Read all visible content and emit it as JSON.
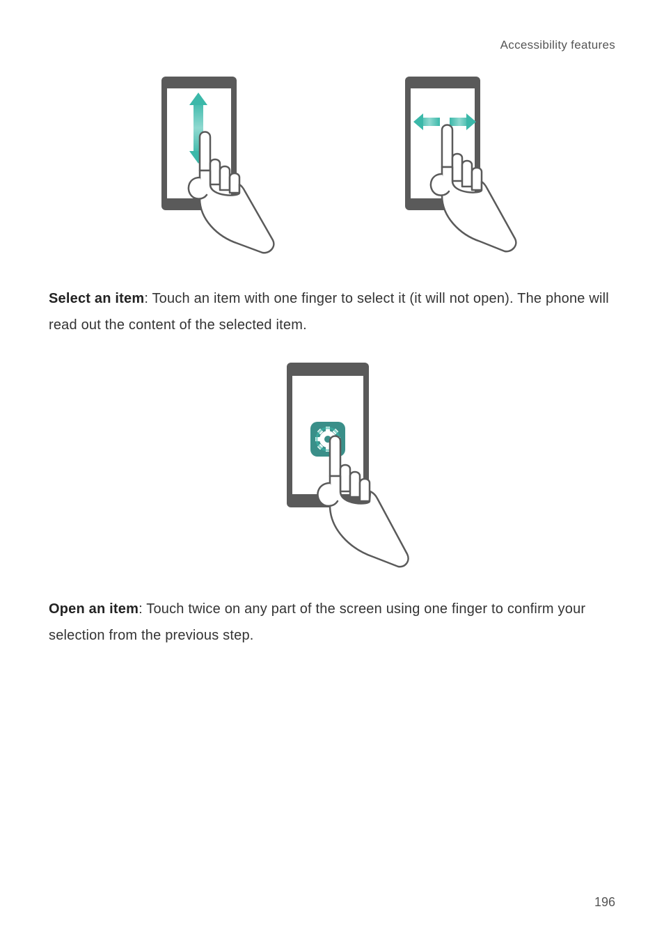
{
  "header": {
    "section_title": "Accessibility features"
  },
  "paragraphs": {
    "select_item": {
      "bold": "Select an item",
      "rest": ": Touch an item with one finger to select it (it will not open). The phone will read out the content of the selected item."
    },
    "open_item": {
      "bold": "Open an item",
      "rest": ": Touch twice on any part of the screen using one finger to confirm your selection from the previous step."
    }
  },
  "figures": {
    "vertical_swipe": "swipe-vertical-illustration",
    "horizontal_swipe": "swipe-horizontal-illustration",
    "tap_select": "tap-select-illustration"
  },
  "page_number": "196"
}
